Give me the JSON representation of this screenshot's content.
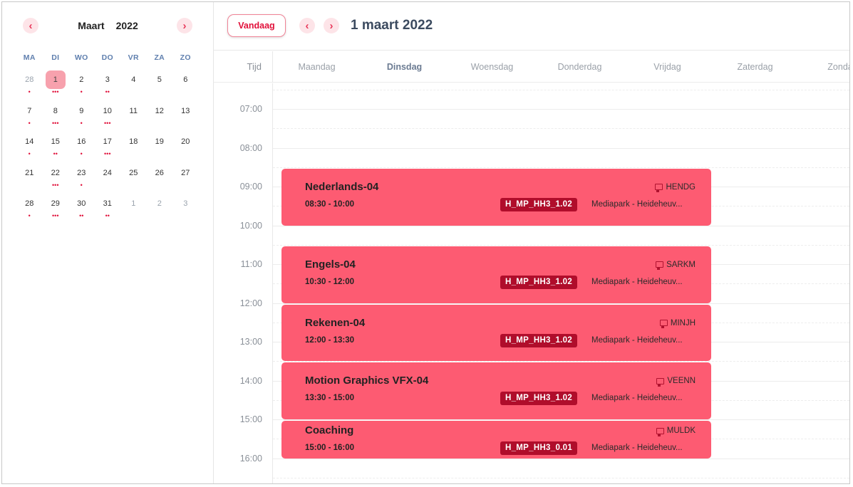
{
  "mini_calendar": {
    "month": "Maart",
    "year": "2022",
    "prev_icon": "‹",
    "next_icon": "›",
    "weekdays": [
      "MA",
      "DI",
      "WO",
      "DO",
      "VR",
      "ZA",
      "ZO"
    ],
    "weeks": [
      [
        {
          "d": "28",
          "other": true,
          "dots": "•"
        },
        {
          "d": "1",
          "selected": true,
          "dots": "•••"
        },
        {
          "d": "2",
          "dots": "•"
        },
        {
          "d": "3",
          "dots": "••"
        },
        {
          "d": "4",
          "dots": ""
        },
        {
          "d": "5",
          "dots": ""
        },
        {
          "d": "6",
          "dots": ""
        }
      ],
      [
        {
          "d": "7",
          "dots": "•"
        },
        {
          "d": "8",
          "dots": "•••"
        },
        {
          "d": "9",
          "dots": "•"
        },
        {
          "d": "10",
          "dots": "•••"
        },
        {
          "d": "11",
          "dots": ""
        },
        {
          "d": "12",
          "dots": ""
        },
        {
          "d": "13",
          "dots": ""
        }
      ],
      [
        {
          "d": "14",
          "dots": "•"
        },
        {
          "d": "15",
          "dots": "••"
        },
        {
          "d": "16",
          "dots": "•"
        },
        {
          "d": "17",
          "dots": "•••"
        },
        {
          "d": "18",
          "dots": ""
        },
        {
          "d": "19",
          "dots": ""
        },
        {
          "d": "20",
          "dots": ""
        }
      ],
      [
        {
          "d": "21",
          "dots": ""
        },
        {
          "d": "22",
          "dots": "•••"
        },
        {
          "d": "23",
          "dots": "•"
        },
        {
          "d": "24",
          "dots": ""
        },
        {
          "d": "25",
          "dots": ""
        },
        {
          "d": "26",
          "dots": ""
        },
        {
          "d": "27",
          "dots": ""
        }
      ],
      [
        {
          "d": "28",
          "dots": "•"
        },
        {
          "d": "29",
          "dots": "•••"
        },
        {
          "d": "30",
          "dots": "••"
        },
        {
          "d": "31",
          "dots": "••"
        },
        {
          "d": "1",
          "other": true,
          "dots": ""
        },
        {
          "d": "2",
          "other": true,
          "dots": ""
        },
        {
          "d": "3",
          "other": true,
          "dots": ""
        }
      ]
    ]
  },
  "toolbar": {
    "today_label": "Vandaag",
    "prev_icon": "‹",
    "next_icon": "›",
    "current_date": "1 maart 2022"
  },
  "columns": {
    "time_header": "Tijd",
    "days": [
      "Maandag",
      "Dinsdag",
      "Woensdag",
      "Donderdag",
      "Vrijdag",
      "Zaterdag",
      "Zondag"
    ],
    "active_day": "Dinsdag"
  },
  "time_labels": [
    "07:00",
    "08:00",
    "09:00",
    "10:00",
    "11:00",
    "12:00",
    "13:00",
    "14:00",
    "15:00",
    "16:00"
  ],
  "events": [
    {
      "title": "Nederlands-04",
      "time": "08:30 - 10:00",
      "teacher": "HENDG",
      "room": "H_MP_HH3_1.02",
      "location": "Mediapark - Heideheuv..."
    },
    {
      "title": "Engels-04",
      "time": "10:30 - 12:00",
      "teacher": "SARKM",
      "room": "H_MP_HH3_1.02",
      "location": "Mediapark - Heideheuv..."
    },
    {
      "title": "Rekenen-04",
      "time": "12:00 - 13:30",
      "teacher": "MINJH",
      "room": "H_MP_HH3_1.02",
      "location": "Mediapark - Heideheuv..."
    },
    {
      "title": "Motion Graphics VFX-04",
      "time": "13:30 - 15:00",
      "teacher": "VEENN",
      "room": "H_MP_HH3_1.02",
      "location": "Mediapark - Heideheuv..."
    },
    {
      "title": "Coaching",
      "time": "15:00 - 16:00",
      "teacher": "MULDK",
      "room": "H_MP_HH3_0.01",
      "location": "Mediapark - Heideheuv..."
    }
  ],
  "colors": {
    "accent": "#e1103a",
    "event_bg": "#fd5b72",
    "room_badge": "#b00d2b",
    "selected_day": "#f7a1ad"
  }
}
